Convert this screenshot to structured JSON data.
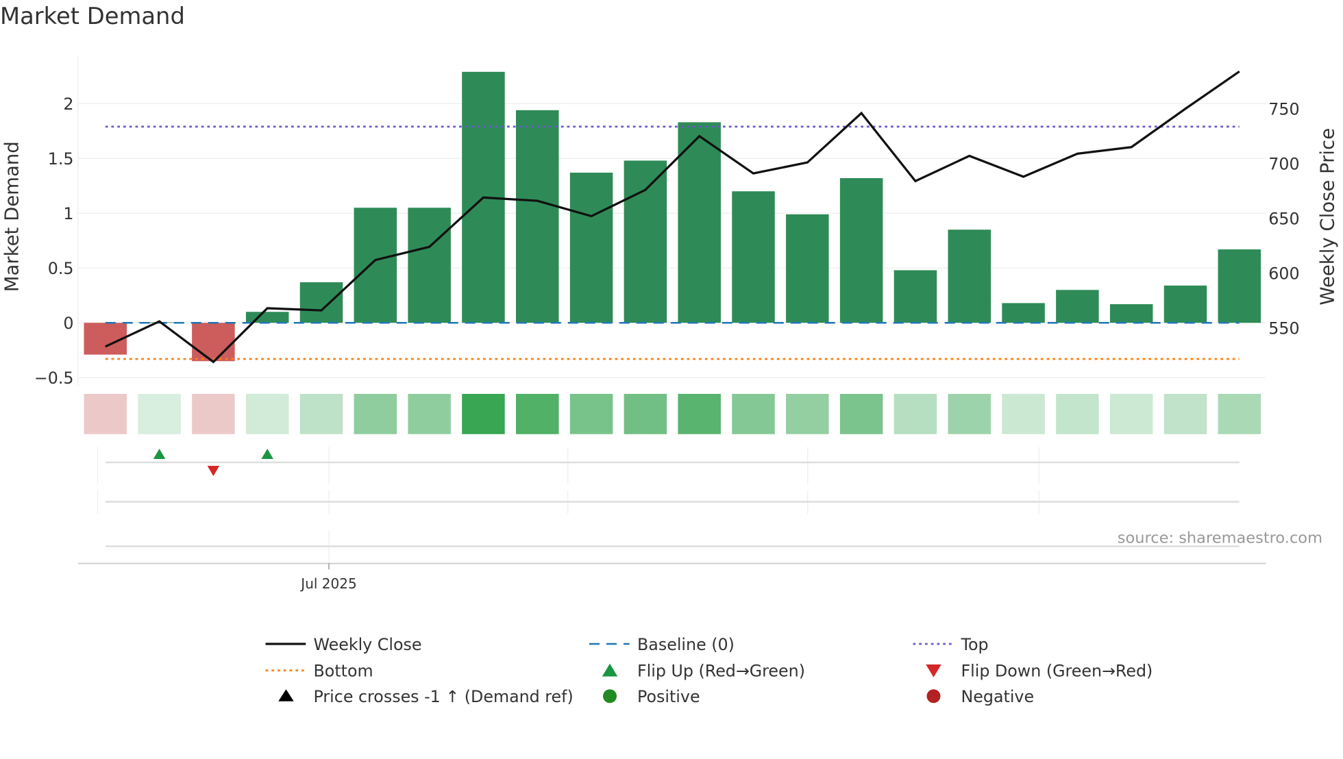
{
  "chart_data": {
    "type": "bar",
    "title": "Market Demand",
    "ylabel": "Market Demand",
    "y2label": "Weekly Close Price",
    "ylim": [
      -0.5,
      2.4
    ],
    "y2lim": [
      550,
      790
    ],
    "yticks": [
      -0.5,
      0,
      0.5,
      1,
      1.5,
      2
    ],
    "ytick_labels": [
      "−0.5",
      "0",
      "0.5",
      "1",
      "1.5",
      "2"
    ],
    "y2ticks": [
      550,
      600,
      650,
      700,
      750
    ],
    "xtick_labels": [
      "Jul 2025"
    ],
    "grid": true,
    "source": "source: sharemaestro.com",
    "demand": [
      -0.29,
      0.005,
      -0.35,
      0.1,
      0.37,
      1.05,
      1.05,
      2.29,
      1.94,
      1.37,
      1.48,
      1.83,
      1.2,
      0.99,
      1.32,
      0.48,
      0.85,
      0.18,
      0.3,
      0.17,
      0.34,
      0.67
    ],
    "weekly_close": [
      533,
      556,
      519,
      568,
      566,
      612,
      624,
      669,
      666,
      652,
      676,
      725,
      691,
      701,
      746,
      684,
      707,
      688,
      709,
      715,
      750,
      784
    ],
    "baseline": 0,
    "top": 1.79,
    "bottom": -0.33,
    "flip_up_weeks": [
      2,
      4
    ],
    "flip_down_weeks": [
      3
    ],
    "colors": {
      "positive_bar": "#2e8b57",
      "negative_bar": "#cd5c5c",
      "line": "#111111",
      "baseline": "#1f77b4",
      "top": "#6a5acd",
      "bottom": "#ff7f0e",
      "flip_up": "#1a9641",
      "flip_down": "#d62728"
    },
    "legend": [
      {
        "label": "Weekly Close",
        "icon": "solid-line"
      },
      {
        "label": "Baseline (0)",
        "icon": "dashed-line"
      },
      {
        "label": "Top",
        "icon": "dotted-line-purple"
      },
      {
        "label": "Bottom",
        "icon": "dotted-line-orange"
      },
      {
        "label": "Flip Up (Red→Green)",
        "icon": "triangle-up-green"
      },
      {
        "label": "Flip Down (Green→Red)",
        "icon": "triangle-down-red"
      },
      {
        "label": "Price crosses -1 ↑ (Demand ref)",
        "icon": "triangle-up-black"
      },
      {
        "label": "Positive",
        "icon": "circle-green"
      },
      {
        "label": "Negative",
        "icon": "circle-red"
      }
    ],
    "legend_placement": "bottom"
  }
}
